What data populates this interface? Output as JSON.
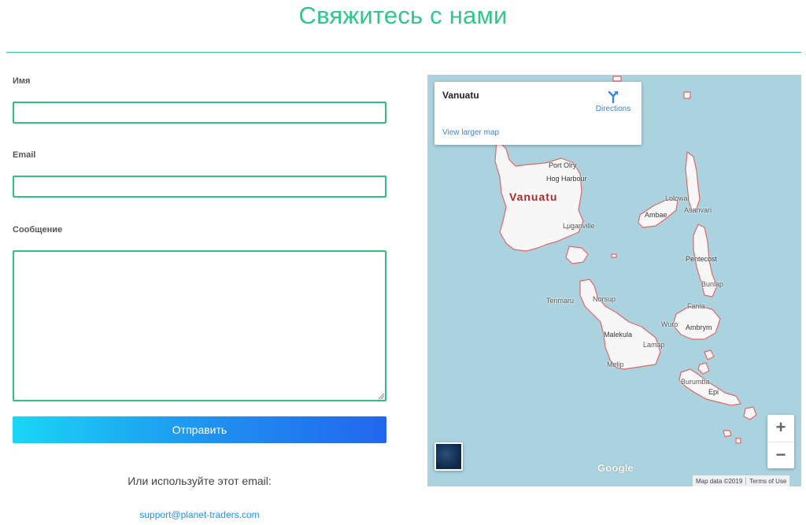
{
  "header": {
    "title": "Свяжитесь с нами"
  },
  "form": {
    "name_label": "Имя",
    "name_value": "",
    "email_label": "Email",
    "email_value": "",
    "message_label": "Сообщение",
    "message_value": "",
    "submit_label": "Отправить"
  },
  "contact": {
    "alt_text": "Или используйте этот email:",
    "email_link": "support@planet-traders.com"
  },
  "map": {
    "place_title": "Vanuatu",
    "directions_label": "Directions",
    "larger_map_label": "View larger map",
    "country_label": "Vanuatu",
    "places": [
      "Port Olry",
      "Hog Harbour",
      "Luganville",
      "Lolowai",
      "Asanvari",
      "Ambae",
      "Pentecost",
      "Bunlap",
      "Fanla",
      "Ambrym",
      "Wuro",
      "Tenmaru",
      "Norsup",
      "Malekula",
      "Lamap",
      "Melip",
      "Burumba",
      "Epi"
    ],
    "logo_text": "Google",
    "attribution": "Map data ©2019",
    "terms": "Terms of Use",
    "zoom_in": "+",
    "zoom_out": "−",
    "colors": {
      "water": "#aad3df",
      "land": "#f7f7f7",
      "border": "#e0686a",
      "link": "#3a84df"
    }
  },
  "theme": {
    "accent": "#2dc88a",
    "button_start": "#1ad6f5",
    "button_end": "#2266ee"
  }
}
